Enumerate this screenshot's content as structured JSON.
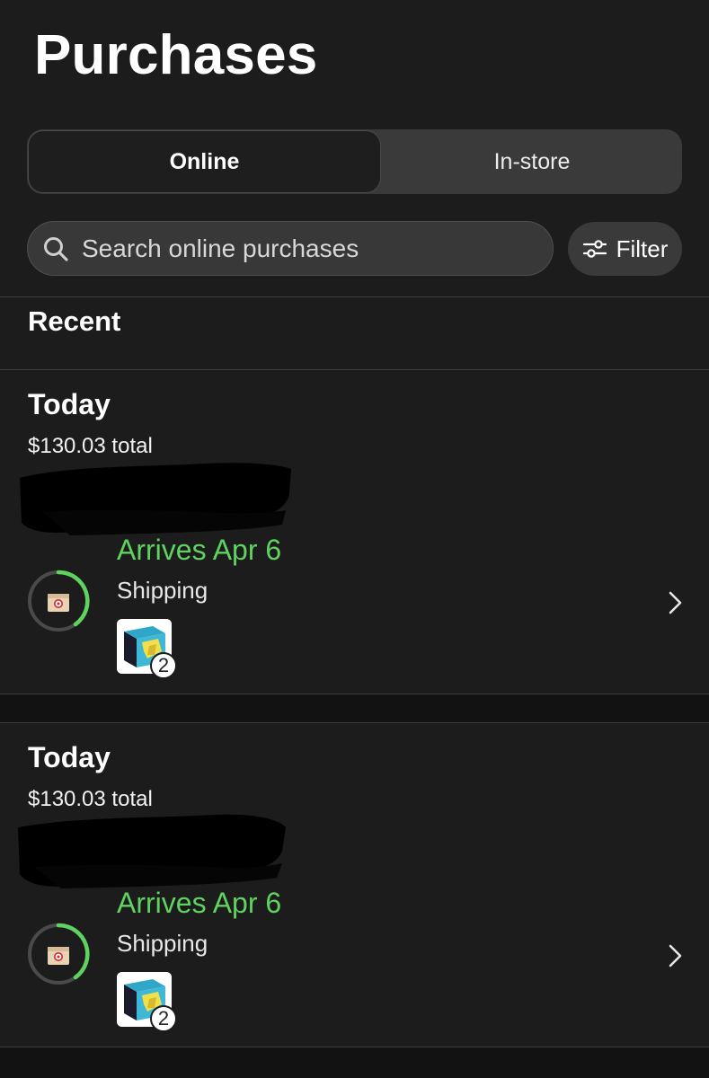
{
  "page": {
    "title": "Purchases"
  },
  "tabs": [
    {
      "label": "Online",
      "selected": true
    },
    {
      "label": "In-store",
      "selected": false
    }
  ],
  "search": {
    "placeholder": "Search online purchases",
    "value": ""
  },
  "filter": {
    "label": "Filter",
    "icon": "sliders-icon"
  },
  "section": {
    "title": "Recent"
  },
  "orders": [
    {
      "date": "Today",
      "total": "$130.03 total",
      "arrival": "Arrives Apr 6",
      "status": "Shipping",
      "item_count": "2",
      "icon": "package-icon"
    },
    {
      "date": "Today",
      "total": "$130.03 total",
      "arrival": "Arrives Apr 6",
      "status": "Shipping",
      "item_count": "2",
      "icon": "package-icon"
    }
  ],
  "colors": {
    "background": "#1c1c1c",
    "accent_green": "#5fd35f",
    "control": "#3a3a3a"
  }
}
